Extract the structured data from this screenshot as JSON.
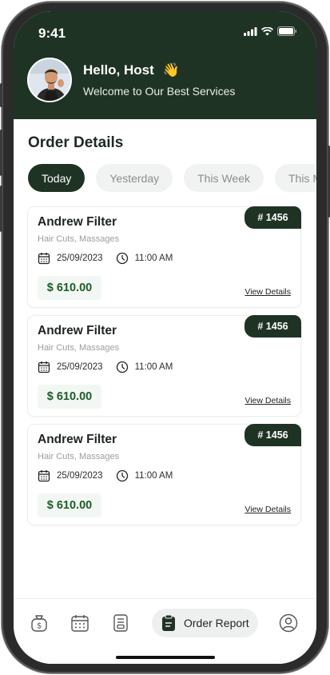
{
  "status_bar": {
    "time": "9:41"
  },
  "header": {
    "greeting": "Hello, Host",
    "wave_emoji": "👋",
    "subtitle": "Welcome to Our Best Services"
  },
  "section": {
    "title": "Order Details"
  },
  "tabs": [
    {
      "label": "Today",
      "active": true
    },
    {
      "label": "Yesterday",
      "active": false
    },
    {
      "label": "This Week",
      "active": false
    },
    {
      "label": "This Month",
      "active": false
    }
  ],
  "orders": [
    {
      "name": "Andrew Filter",
      "services": "Hair Cuts, Massages",
      "order_no": "# 1456",
      "date": "25/09/2023",
      "time": "11:00 AM",
      "amount": "$ 610.00",
      "action": "View Details"
    },
    {
      "name": "Andrew Filter",
      "services": "Hair Cuts, Massages",
      "order_no": "# 1456",
      "date": "25/09/2023",
      "time": "11:00 AM",
      "amount": "$ 610.00",
      "action": "View Details"
    },
    {
      "name": "Andrew Filter",
      "services": "Hair Cuts, Massages",
      "order_no": "# 1456",
      "date": "25/09/2023",
      "time": "11:00 AM",
      "amount": "$ 610.00",
      "action": "View Details"
    }
  ],
  "bottom_nav": {
    "items": [
      {
        "icon": "money-bag-icon"
      },
      {
        "icon": "calendar-icon"
      },
      {
        "icon": "receipt-icon"
      },
      {
        "icon": "clipboard-icon",
        "label": "Order Report",
        "active": true
      },
      {
        "icon": "profile-icon"
      }
    ]
  },
  "colors": {
    "primary": "#1f3324",
    "price": "#1b5e2a",
    "tab_inactive_bg": "#f1f2f2"
  }
}
